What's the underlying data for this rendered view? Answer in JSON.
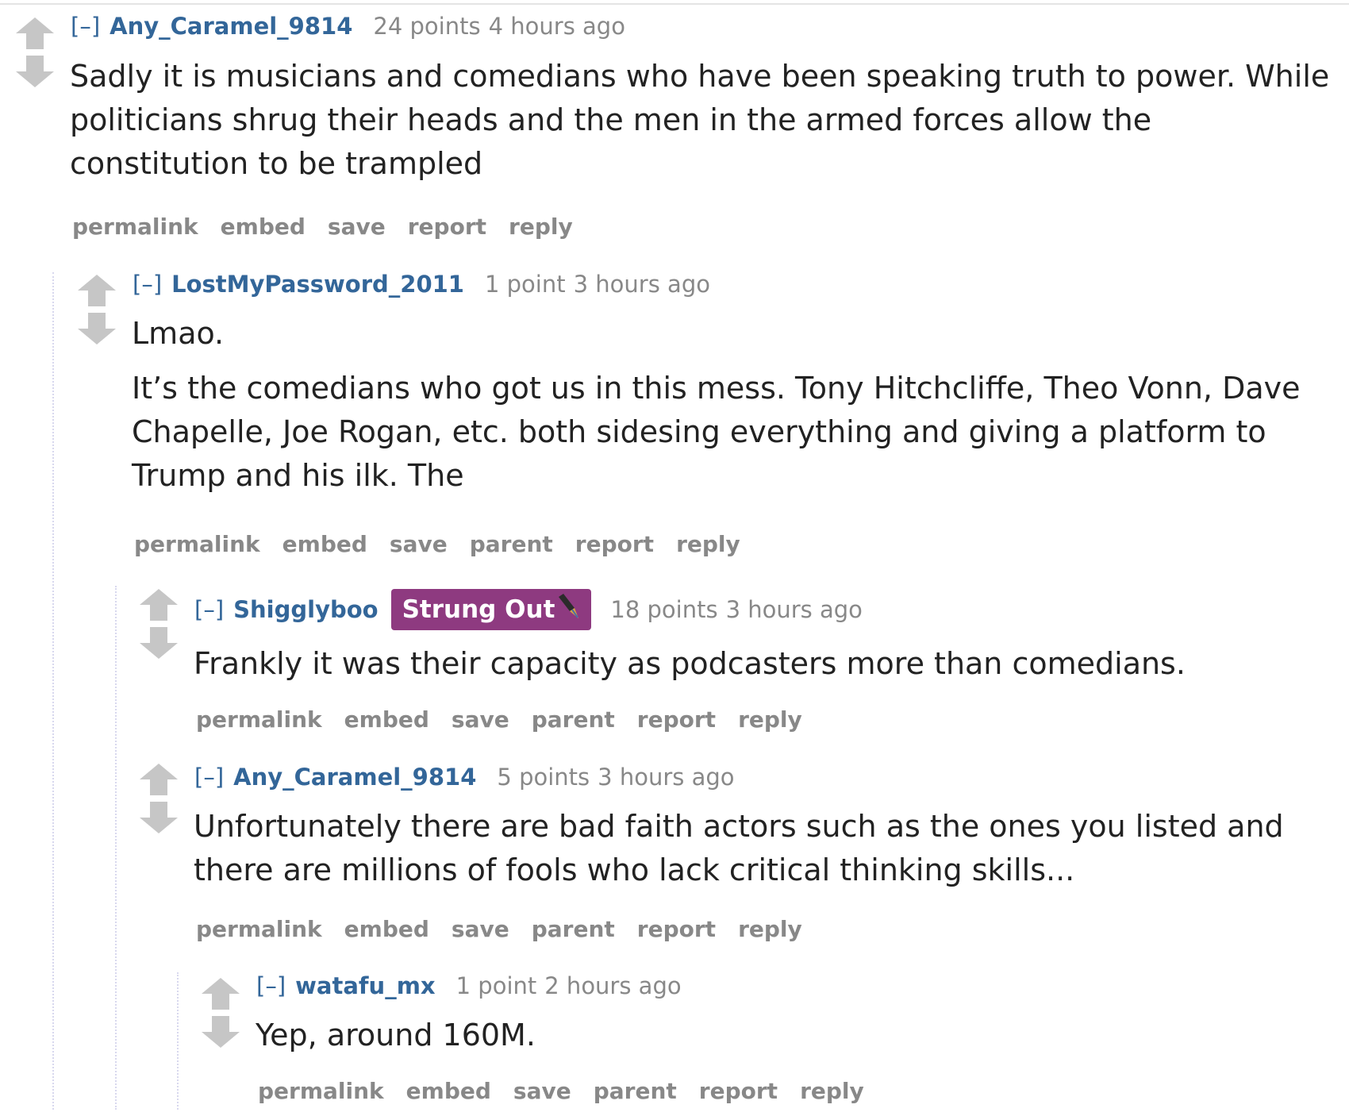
{
  "expand_label": "[–]",
  "comments": [
    {
      "author": "Any_Caramel_9814",
      "score": "24 points",
      "time": "4 hours ago",
      "body": [
        "Sadly it is musicians and comedians who have been speaking truth to power. While politicians shrug their heads and the men in the armed forces allow the constitution to be trampled"
      ],
      "buttons": [
        "permalink",
        "embed",
        "save",
        "report",
        "reply"
      ]
    },
    {
      "author": "LostMyPassword_2011",
      "score": "1 point",
      "time": "3 hours ago",
      "body": [
        "Lmao.",
        "It’s the comedians who got us in this mess. Tony Hitchcliffe, Theo Vonn, Dave Chapelle, Joe Rogan, etc. both sidesing everything and giving a platform to Trump and his ilk. The"
      ],
      "buttons": [
        "permalink",
        "embed",
        "save",
        "parent",
        "report",
        "reply"
      ]
    },
    {
      "author": "Shigglyboo",
      "flair": "Strung Out",
      "flair_icon": "fountain-pen-icon",
      "score": "18 points",
      "time": "3 hours ago",
      "body": [
        "Frankly it was their capacity as podcasters more than comedians."
      ],
      "buttons": [
        "permalink",
        "embed",
        "save",
        "parent",
        "report",
        "reply"
      ]
    },
    {
      "author": "Any_Caramel_9814",
      "score": "5 points",
      "time": "3 hours ago",
      "body": [
        "Unfortunately there are bad faith actors such as the ones you listed and there are millions of fools who lack critical thinking skills..."
      ],
      "buttons": [
        "permalink",
        "embed",
        "save",
        "parent",
        "report",
        "reply"
      ]
    },
    {
      "author": "watafu_mx",
      "score": "1 point",
      "time": "2 hours ago",
      "body": [
        "Yep, around 160M."
      ],
      "buttons": [
        "permalink",
        "embed",
        "save",
        "parent",
        "report",
        "reply"
      ]
    }
  ],
  "colors": {
    "author": "#336699",
    "meta": "#888888",
    "body": "#222222",
    "flair_bg": "#8e3a80",
    "vote_arrow": "#c6c6c6",
    "thread_line": "#d8d8ee"
  },
  "icons": {
    "upvote": "upvote-arrow-icon",
    "downvote": "downvote-arrow-icon"
  }
}
